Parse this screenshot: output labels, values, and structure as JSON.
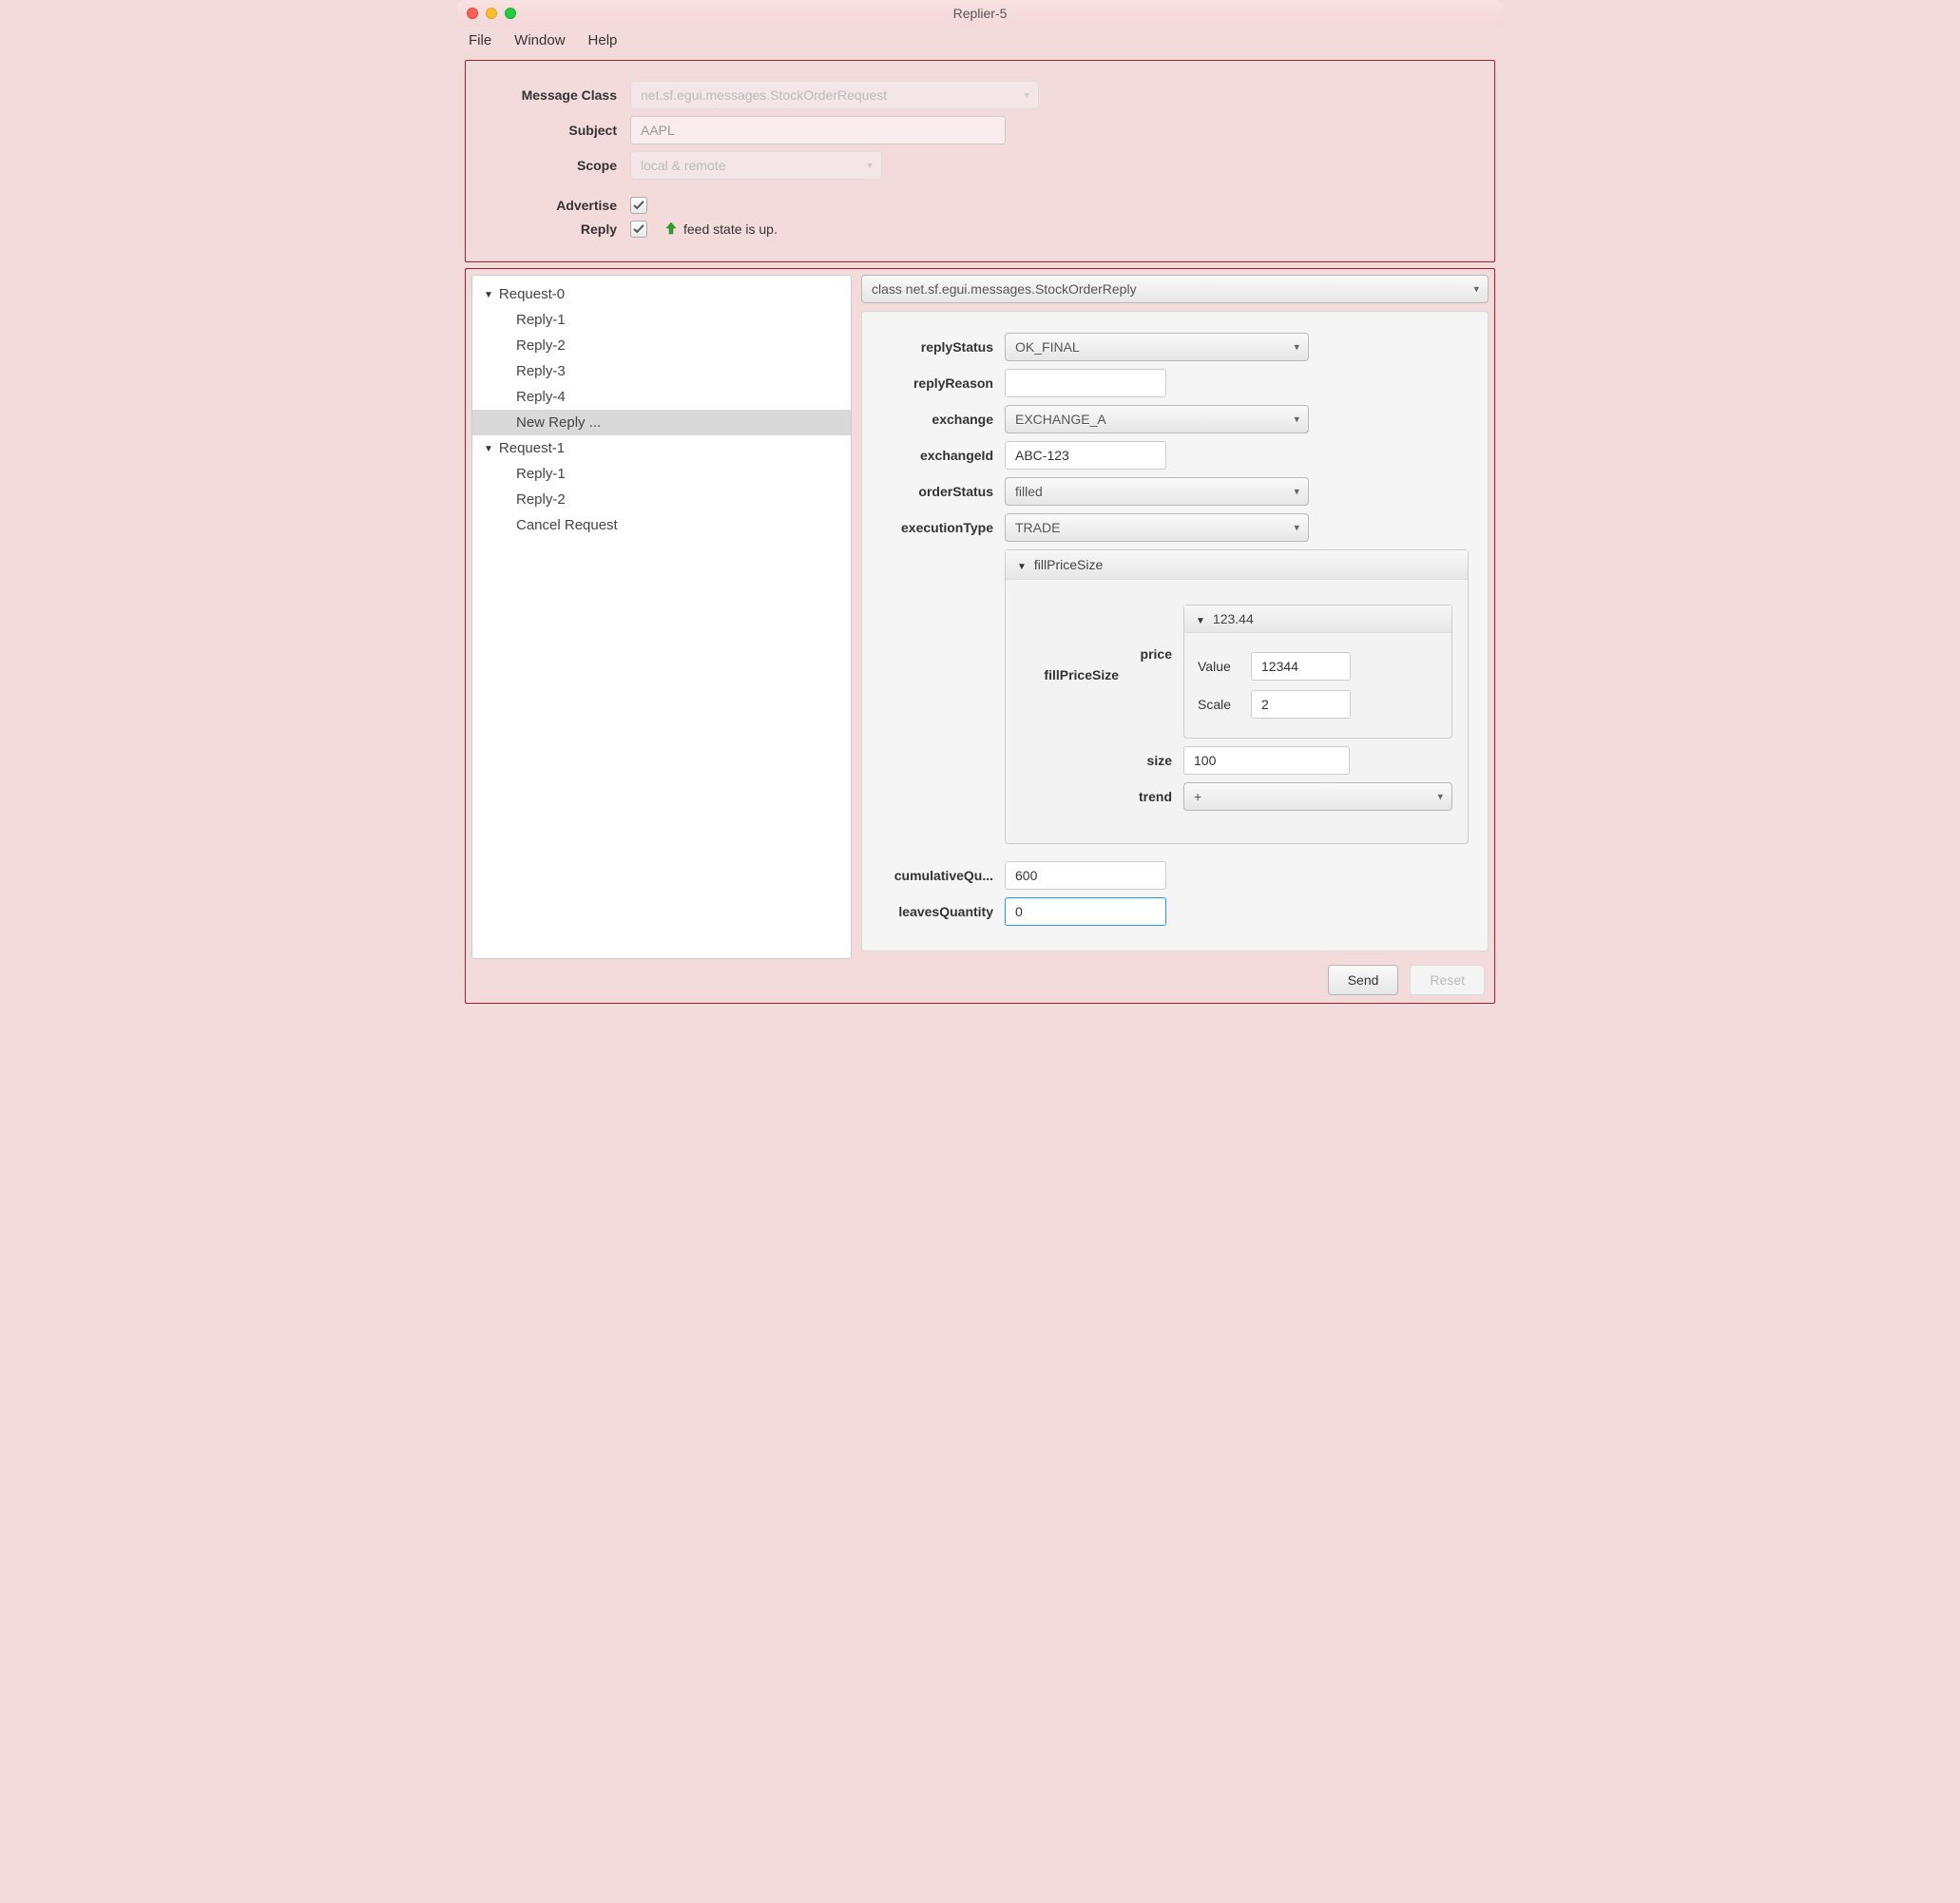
{
  "window": {
    "title": "Replier-5"
  },
  "menus": {
    "file": "File",
    "window": "Window",
    "help": "Help"
  },
  "top": {
    "messageClass": {
      "label": "Message Class",
      "value": "net.sf.egui.messages.StockOrderRequest"
    },
    "subject": {
      "label": "Subject",
      "value": "AAPL"
    },
    "scope": {
      "label": "Scope",
      "value": "local & remote"
    },
    "advertise": {
      "label": "Advertise"
    },
    "reply": {
      "label": "Reply"
    },
    "feed": "feed state is up."
  },
  "tree": {
    "req0": "Request-0",
    "r01": "Reply-1",
    "r02": "Reply-2",
    "r03": "Reply-3",
    "r04": "Reply-4",
    "newReply": "New Reply ...",
    "req1": "Request-1",
    "r11": "Reply-1",
    "r12": "Reply-2",
    "cancel": "Cancel Request"
  },
  "classSelect": "class net.sf.egui.messages.StockOrderReply",
  "props": {
    "replyStatus": {
      "label": "replyStatus",
      "value": "OK_FINAL"
    },
    "replyReason": {
      "label": "replyReason",
      "value": ""
    },
    "exchange": {
      "label": "exchange",
      "value": "EXCHANGE_A"
    },
    "exchangeId": {
      "label": "exchangeId",
      "value": "ABC-123"
    },
    "orderStatus": {
      "label": "orderStatus",
      "value": "filled"
    },
    "executionType": {
      "label": "executionType",
      "value": "TRADE"
    },
    "fillPriceSizeHeader": "fillPriceSize",
    "fillPriceSize": {
      "label": "fillPriceSize",
      "priceLabel": "price",
      "priceHeader": "123.44",
      "valueLabel": "Value",
      "value": "12344",
      "scaleLabel": "Scale",
      "scale": "2",
      "sizeLabel": "size",
      "size": "100",
      "trendLabel": "trend",
      "trend": "+"
    },
    "cumulativeQuantity": {
      "label": "cumulativeQu...",
      "value": "600"
    },
    "leavesQuantity": {
      "label": "leavesQuantity",
      "value": "0"
    }
  },
  "buttons": {
    "send": "Send",
    "reset": "Reset"
  }
}
